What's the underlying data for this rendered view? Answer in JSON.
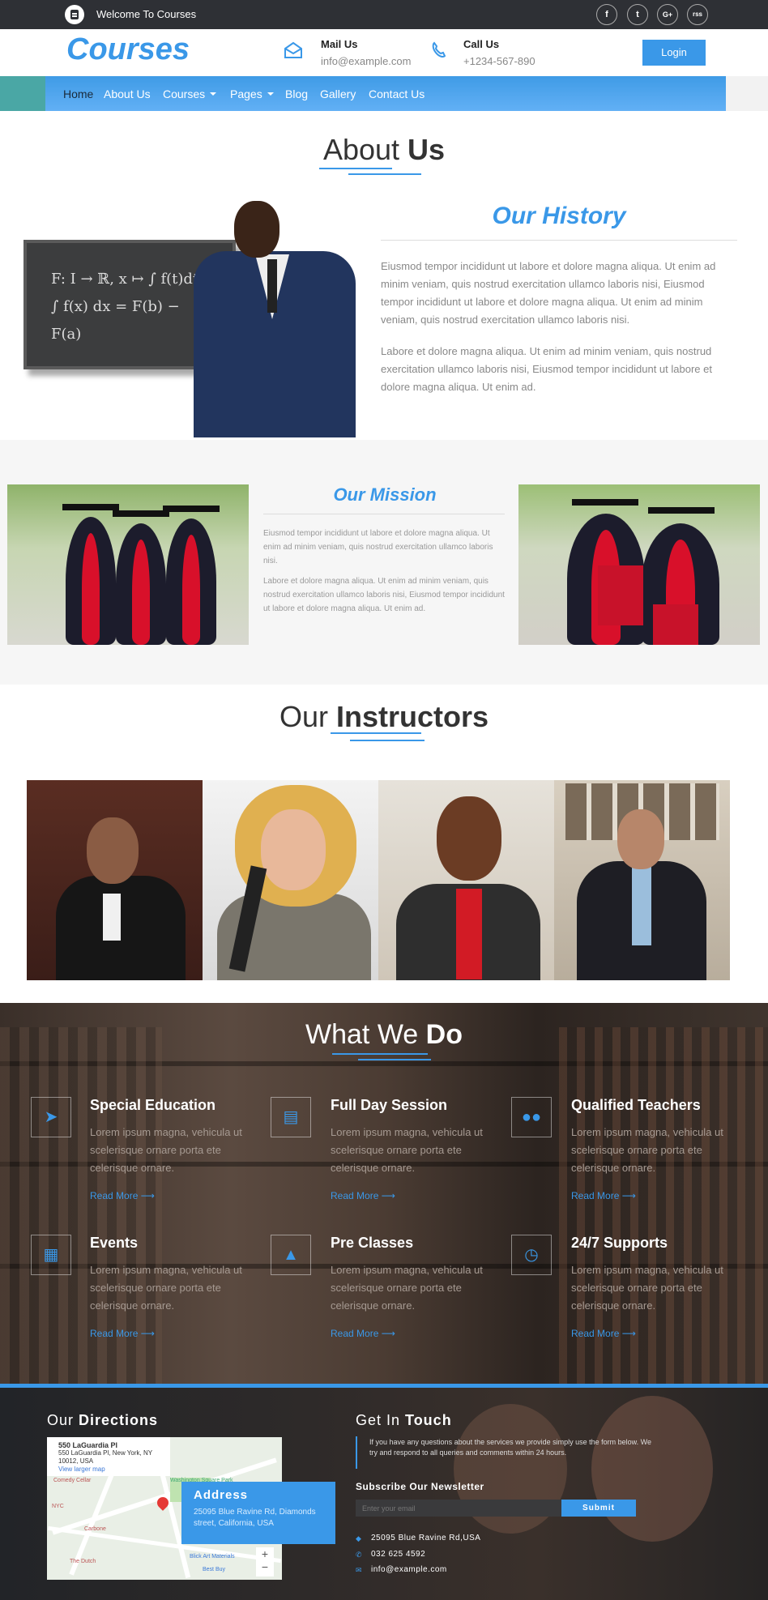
{
  "topbar": {
    "welcome": "Welcome To Courses",
    "social": [
      "f",
      "t",
      "G+",
      "rss"
    ]
  },
  "header": {
    "brand": "Courses",
    "mail_label": "Mail Us",
    "mail_value": "info@example.com",
    "call_label": "Call Us",
    "call_value": "+1234-567-890",
    "login": "Login"
  },
  "nav": [
    "Home",
    "About Us",
    "Courses",
    "Pages",
    "Blog",
    "Gallery",
    "Contact Us"
  ],
  "about": {
    "title_a": "About ",
    "title_b": "Us",
    "history_title": "Our History",
    "p1": "Eiusmod tempor incididunt ut labore et dolore magna aliqua. Ut enim ad minim veniam, quis nostrud exercitation ullamco laboris nisi, Eiusmod tempor incididunt ut labore et dolore magna aliqua. Ut enim ad minim veniam, quis nostrud exercitation ullamco laboris nisi.",
    "p2": "Labore et dolore magna aliqua. Ut enim ad minim veniam, quis nostrud exercitation ullamco laboris nisi, Eiusmod tempor incididunt ut labore et dolore magna aliqua. Ut enim ad."
  },
  "mission": {
    "title": "Our Mission",
    "p1": "Eiusmod tempor incididunt ut labore et dolore magna aliqua. Ut enim ad minim veniam, quis nostrud exercitation ullamco laboris nisi.",
    "p2": "Labore et dolore magna aliqua. Ut enim ad minim veniam, quis nostrud exercitation ullamco laboris nisi, Eiusmod tempor incididunt ut labore et dolore magna aliqua. Ut enim ad."
  },
  "instructors": {
    "title_a": "Our ",
    "title_b": "Instructors"
  },
  "whatwedo": {
    "title_a": "What We ",
    "title_b": "Do",
    "services": [
      {
        "title": "Special Education",
        "text": "Lorem ipsum magna, vehicula ut scelerisque ornare porta ete celerisque ornare.",
        "more": "Read More"
      },
      {
        "title": "Full Day Session",
        "text": "Lorem ipsum magna, vehicula ut scelerisque ornare porta ete celerisque ornare.",
        "more": "Read More"
      },
      {
        "title": "Qualified Teachers",
        "text": "Lorem ipsum magna, vehicula ut scelerisque ornare porta ete celerisque ornare.",
        "more": "Read More"
      },
      {
        "title": "Events",
        "text": "Lorem ipsum magna, vehicula ut scelerisque ornare porta ete celerisque ornare.",
        "more": "Read More"
      },
      {
        "title": "Pre Classes",
        "text": "Lorem ipsum magna, vehicula ut scelerisque ornare porta ete celerisque ornare.",
        "more": "Read More"
      },
      {
        "title": "24/7 Supports",
        "text": "Lorem ipsum magna, vehicula ut scelerisque ornare porta ete celerisque ornare.",
        "more": "Read More"
      }
    ]
  },
  "footer": {
    "directions_a": "Our ",
    "directions_b": "Directions",
    "map_place": "550 LaGuardia Pl",
    "map_address": "550 LaGuardia Pl, New York, NY 10012, USA",
    "map_link": "View larger map",
    "map_labels": [
      "Washington Square Park",
      "Comedy Cellar",
      "Carbone",
      "The Dutch",
      "Blick Art Materials",
      "Best Buy",
      "NYC"
    ],
    "address_title": "Address",
    "address_value": "25095 Blue Ravine Rd, Diamonds street, California, USA",
    "touch_a": "Get In ",
    "touch_b": "Touch",
    "touch_text": "If you have any questions about the services we provide simply use the form below. We try and respond to all queries and comments within 24 hours.",
    "newsletter_title": "Subscribe Our Newsletter",
    "email_placeholder": "Enter your email",
    "submit": "Submit",
    "contact_address": "25095 Blue Ravine Rd,USA",
    "contact_phone": "032 625 4592",
    "contact_email": "info@example.com"
  }
}
